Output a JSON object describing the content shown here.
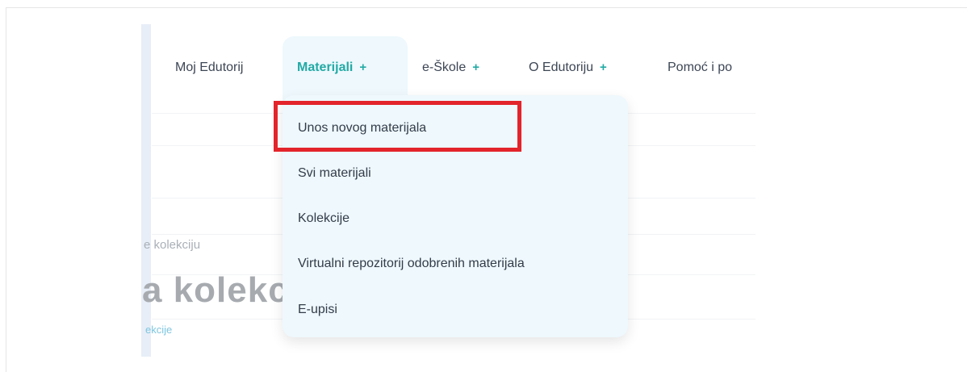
{
  "nav": {
    "items": [
      {
        "label": "Moj Edutorij",
        "plus": ""
      },
      {
        "label": "Materijali",
        "plus": "+"
      },
      {
        "label": "e-Škole",
        "plus": "+"
      },
      {
        "label": "O Edutoriju",
        "plus": "+"
      },
      {
        "label": "Pomoć i po",
        "plus": ""
      }
    ]
  },
  "dropdown": {
    "items": [
      "Unos novog materijala",
      "Svi materijali",
      "Kolekcije",
      "Virtualni repozitorij odobrenih materijala",
      "E-upisi"
    ]
  },
  "background": {
    "breadcrumb": "e kolekciju",
    "title": "a kolekc",
    "sublink": "ekcije"
  },
  "colors": {
    "accent": "#23aaa5",
    "highlight": "#e3242b",
    "dropdown_bg": "#eef8fd"
  }
}
